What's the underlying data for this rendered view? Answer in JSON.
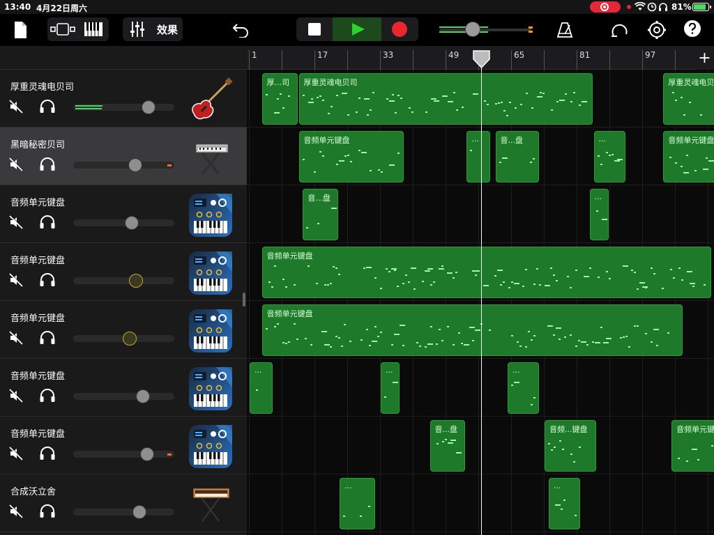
{
  "status_bar": {
    "time": "13:40",
    "date": "4月22日周六",
    "battery": "81%"
  },
  "toolbar": {
    "effects_label": "效果"
  },
  "ruler": {
    "labels": [
      "1",
      "17",
      "33",
      "49",
      "65",
      "81",
      "97"
    ]
  },
  "tracks": [
    {
      "name": "厚重灵魂电贝司",
      "instrument": "bass-guitar",
      "volume": 0.78,
      "selected": false,
      "meter": 0.27,
      "clip": false,
      "ring": false
    },
    {
      "name": "黑暗秘密贝司",
      "instrument": "keyboard-stand",
      "volume": 0.63,
      "selected": true,
      "meter": 0,
      "clip": true,
      "ring": false
    },
    {
      "name": "音频单元键盘",
      "instrument": "au-keyboard",
      "volume": 0.59,
      "selected": false,
      "meter": 0,
      "clip": false,
      "ring": false
    },
    {
      "name": "音频单元键盘",
      "instrument": "au-keyboard",
      "volume": 0.64,
      "selected": false,
      "meter": 0,
      "clip": false,
      "ring": true
    },
    {
      "name": "音频单元键盘",
      "instrument": "au-keyboard",
      "volume": 0.57,
      "selected": false,
      "meter": 0,
      "clip": false,
      "ring": true
    },
    {
      "name": "音频单元键盘",
      "instrument": "au-keyboard",
      "volume": 0.72,
      "selected": false,
      "meter": 0,
      "clip": false,
      "ring": false
    },
    {
      "name": "音频单元键盘",
      "instrument": "au-keyboard",
      "volume": 0.77,
      "selected": false,
      "meter": 0,
      "clip": true,
      "ring": false
    },
    {
      "name": "合成沃立舍",
      "instrument": "synth-stand",
      "volume": 0.68,
      "selected": false,
      "meter": 0,
      "clip": false,
      "ring": false
    }
  ],
  "regions": [
    {
      "track": 0,
      "start": 4,
      "end": 13,
      "title": "厚...司"
    },
    {
      "track": 0,
      "start": 13,
      "end": 85,
      "title": "厚重灵魂电贝司"
    },
    {
      "track": 0,
      "start": 102,
      "end": 122,
      "title": "厚重灵魂电贝司"
    },
    {
      "track": 1,
      "start": 13,
      "end": 39,
      "title": "音频单元键盘"
    },
    {
      "track": 1,
      "start": 54,
      "end": 60,
      "title": "..."
    },
    {
      "track": 1,
      "start": 61,
      "end": 72,
      "title": "音...盘"
    },
    {
      "track": 1,
      "start": 85,
      "end": 93,
      "title": "..."
    },
    {
      "track": 1,
      "start": 102,
      "end": 119,
      "title": "音频单元键盘"
    },
    {
      "track": 1,
      "start": 119,
      "end": 121,
      "title": ""
    },
    {
      "track": 2,
      "start": 14,
      "end": 23,
      "title": "音...盘"
    },
    {
      "track": 2,
      "start": 84,
      "end": 89,
      "title": "..."
    },
    {
      "track": 3,
      "start": 4,
      "end": 114,
      "title": "音频单元键盘"
    },
    {
      "track": 4,
      "start": 4,
      "end": 107,
      "title": "音频单元键盘"
    },
    {
      "track": 5,
      "start": 1,
      "end": 7,
      "title": "..."
    },
    {
      "track": 5,
      "start": 33,
      "end": 38,
      "title": "..."
    },
    {
      "track": 5,
      "start": 64,
      "end": 72,
      "title": "..."
    },
    {
      "track": 6,
      "start": 45,
      "end": 54,
      "title": "音...盘"
    },
    {
      "track": 6,
      "start": 73,
      "end": 86,
      "title": "音频...键盘"
    },
    {
      "track": 6,
      "start": 104,
      "end": 121,
      "title": "音频单元键盘"
    },
    {
      "track": 7,
      "start": 23,
      "end": 32,
      "title": "..."
    },
    {
      "track": 7,
      "start": 74,
      "end": 82,
      "title": "..."
    }
  ]
}
